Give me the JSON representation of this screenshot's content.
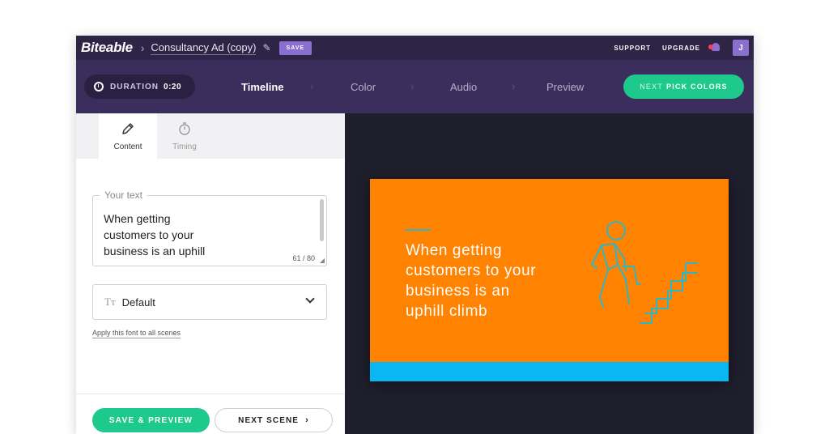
{
  "topbar": {
    "brand": "Biteable",
    "breadcrumb_sep": "›",
    "project_title": "Consultancy Ad (copy)",
    "save_label": "SAVE",
    "links": [
      "SUPPORT",
      "UPGRADE"
    ],
    "avatar_initial": "J",
    "bell_dot_color": "#ff3c5a"
  },
  "stepbar": {
    "duration_label": "DURATION",
    "duration_value": "0:20",
    "steps": [
      "Timeline",
      "Color",
      "Audio",
      "Preview"
    ],
    "active_step": "Timeline",
    "separator": "›",
    "next_label_prefix": "NEXT",
    "next_label_main": "PICK COLORS"
  },
  "editor": {
    "tabs": [
      {
        "label": "Content",
        "icon": "pencil-icon",
        "active": true
      },
      {
        "label": "Timing",
        "icon": "stopwatch-icon",
        "active": false
      }
    ],
    "text_field": {
      "legend": "Your text",
      "value": "When getting customers to your business is an uphill climb",
      "counter": "61 / 80"
    },
    "font_select": {
      "icon_glyph": "Tт",
      "value": "Default"
    },
    "apply_font_link": "Apply this font to all scenes",
    "save_preview_label": "SAVE & PREVIEW",
    "next_scene_label": "NEXT SCENE",
    "next_scene_arrow": "›"
  },
  "preview": {
    "scene_text_lines": [
      "When getting",
      "customers to your",
      "business is an",
      "uphill climb"
    ],
    "scene_bg": "#ff8200",
    "scene_bar_color": "#0bb7f0",
    "illustration": "person-climbing-stairs-icon"
  },
  "colors": {
    "accent_green": "#1ec98d",
    "purple": "#8a6fd0",
    "topbar": "#2e2446",
    "stepbar": "#3b2e5c"
  }
}
